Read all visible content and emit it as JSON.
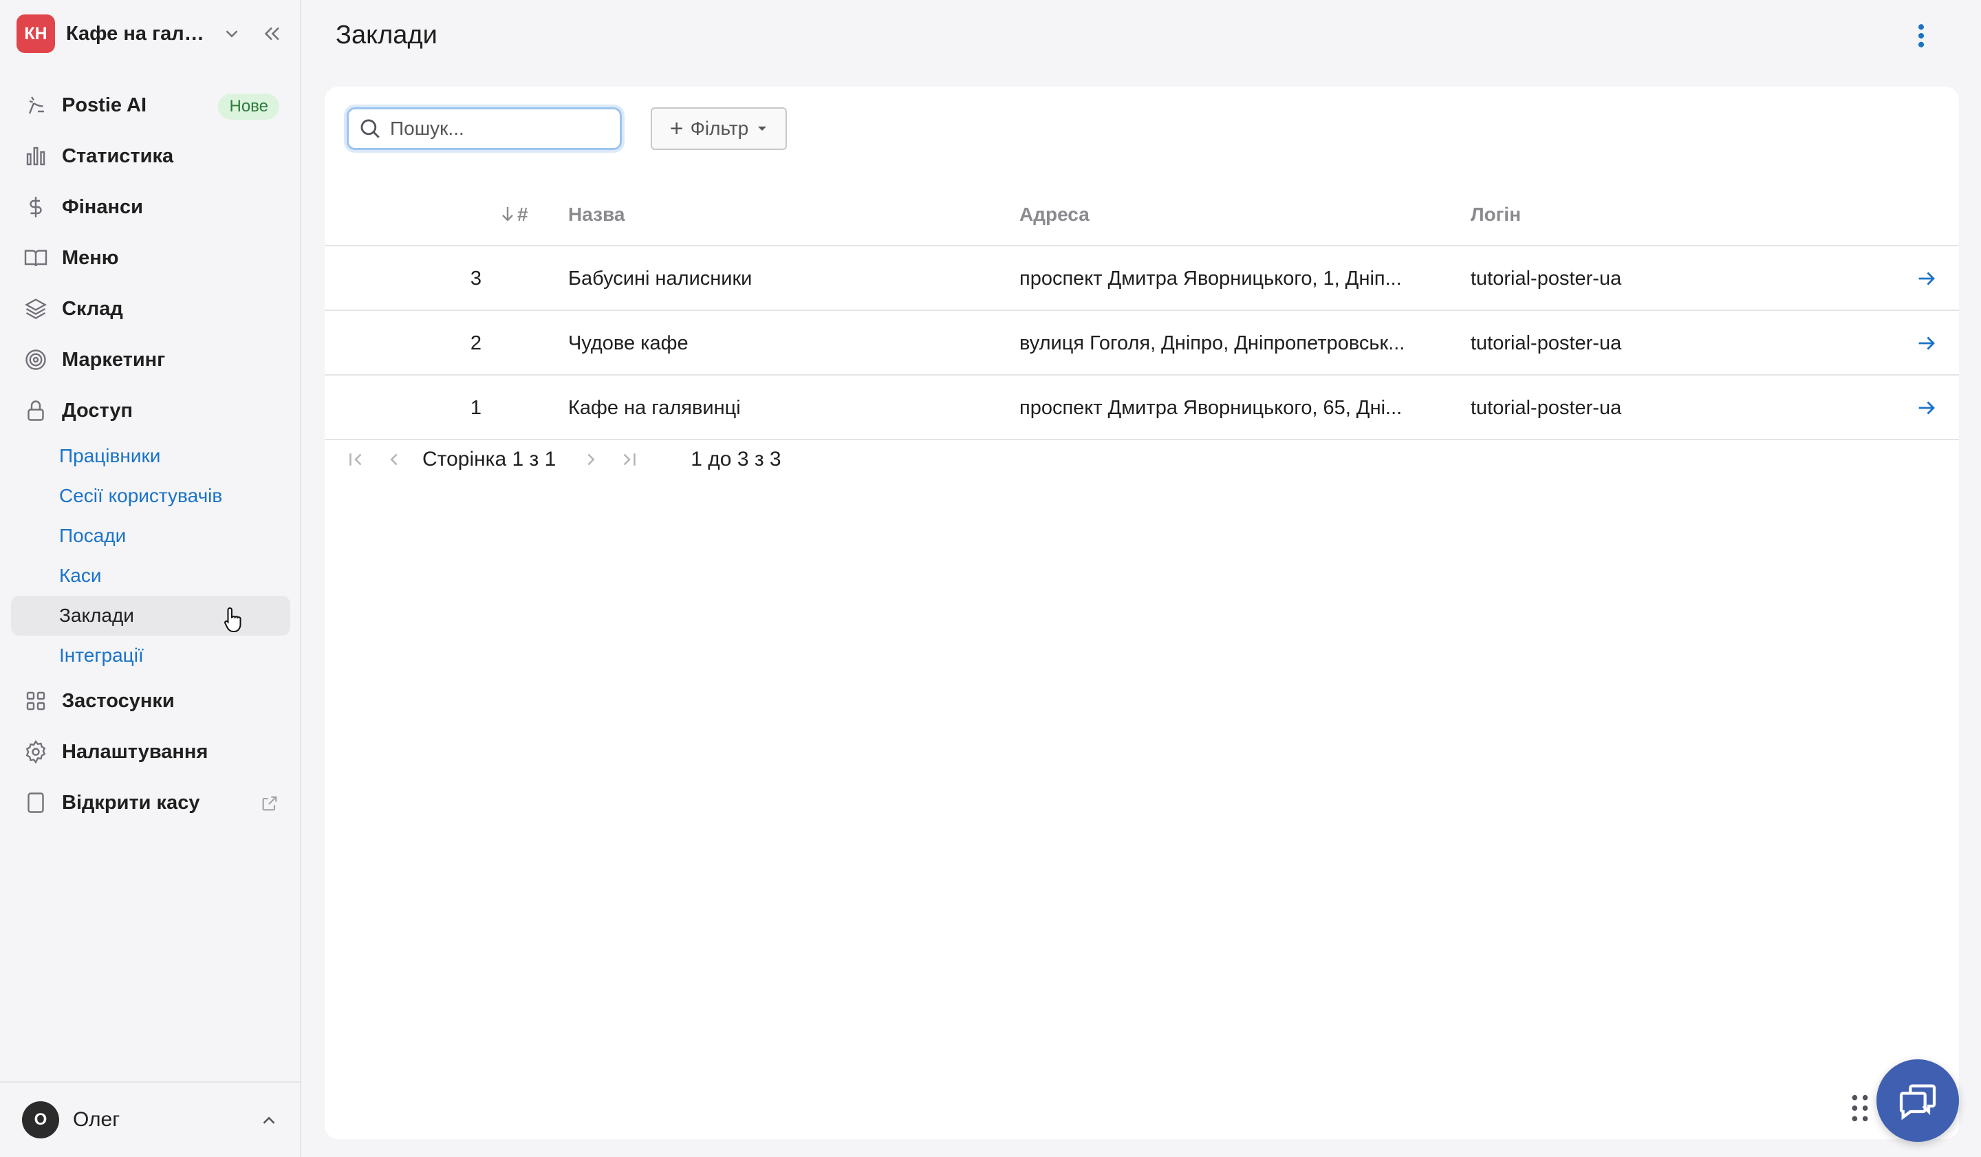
{
  "brand": {
    "initials": "КН",
    "name": "Кафе на галя..."
  },
  "nav": {
    "postie": {
      "label": "Postie AI",
      "badge": "Нове"
    },
    "stats": {
      "label": "Статистика"
    },
    "finance": {
      "label": "Фінанси"
    },
    "menu": {
      "label": "Меню"
    },
    "stock": {
      "label": "Склад"
    },
    "marketing": {
      "label": "Маркетинг"
    },
    "access": {
      "label": "Доступ",
      "items": [
        "Працівники",
        "Сесії користувачів",
        "Посади",
        "Каси",
        "Заклади",
        "Інтеграції"
      ]
    },
    "apps": {
      "label": "Застосунки"
    },
    "settings": {
      "label": "Налаштування"
    },
    "open_register": {
      "label": "Відкрити касу"
    }
  },
  "user": {
    "initial": "О",
    "name": "Олег"
  },
  "page": {
    "title": "Заклади"
  },
  "toolbar": {
    "search_placeholder": "Пошук...",
    "filter_label": "Фільтр"
  },
  "table": {
    "columns": {
      "num": "#",
      "name": "Назва",
      "address": "Адреса",
      "login": "Логін"
    },
    "rows": [
      {
        "num": "3",
        "name": "Бабусині налисники",
        "address": "проспект Дмитра Яворницького, 1, Дніп...",
        "login": "tutorial-poster-ua"
      },
      {
        "num": "2",
        "name": "Чудове кафе",
        "address": "вулиця Гоголя, Дніпро, Дніпропетровськ...",
        "login": "tutorial-poster-ua"
      },
      {
        "num": "1",
        "name": "Кафе на галявинці",
        "address": "проспект Дмитра Яворницького, 65, Дні...",
        "login": "tutorial-poster-ua"
      }
    ]
  },
  "pagination": {
    "page_text": "Сторінка 1 з 1",
    "range_text": "1 до 3 з 3"
  },
  "colors": {
    "accent": "#1a73c8",
    "brand_badge": "#e0454b",
    "chat_button": "#3f5fb0"
  }
}
